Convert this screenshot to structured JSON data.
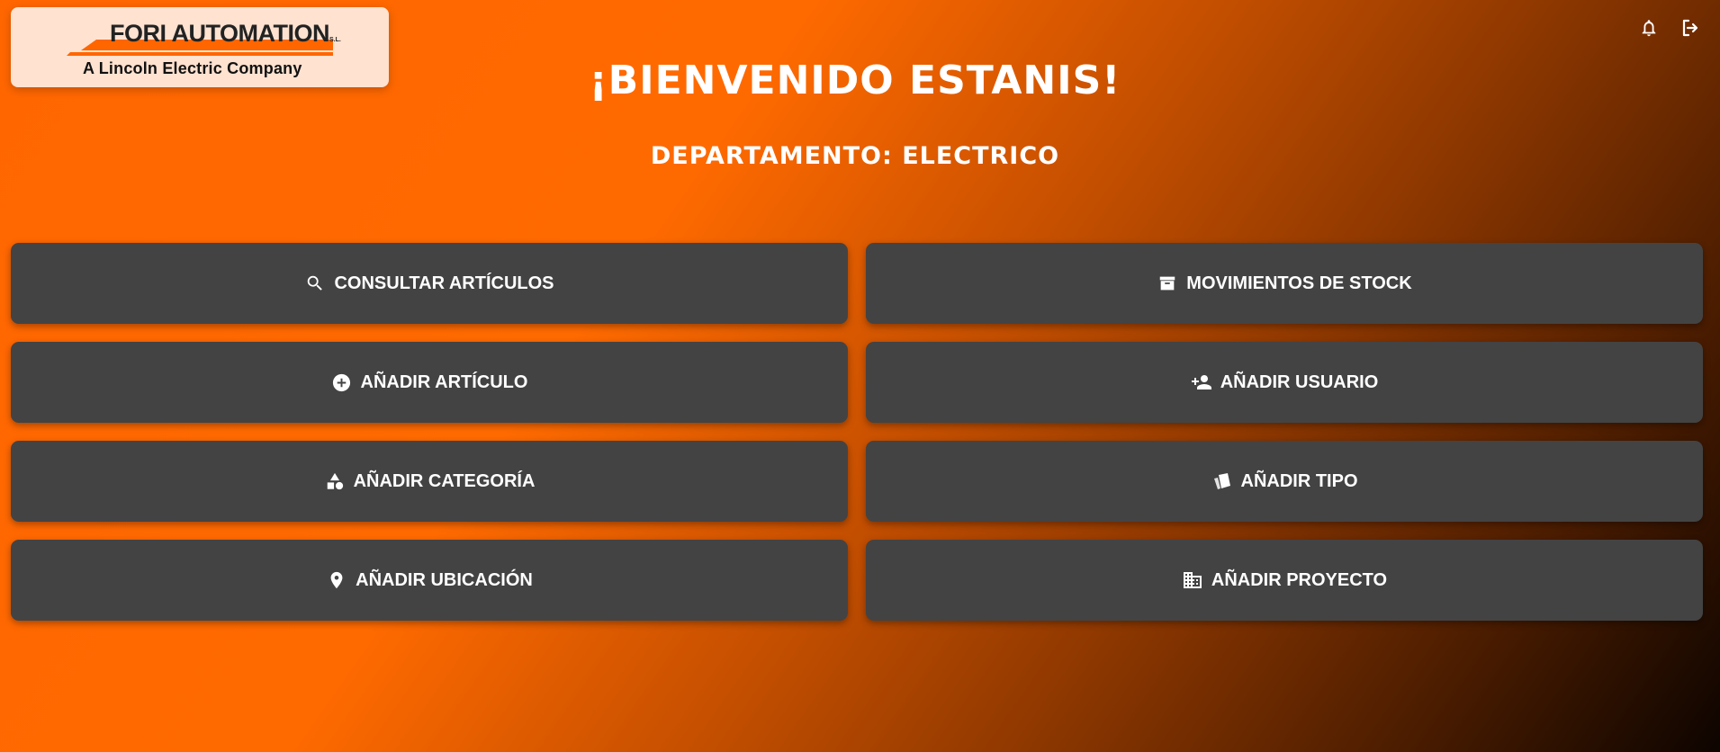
{
  "logo": {
    "title": "FORI AUTOMATION",
    "suffix": "S.L.",
    "subtitle": "A Lincoln Electric Company"
  },
  "header": {
    "icons": [
      "bell-icon",
      "logout-icon"
    ]
  },
  "welcome": "¡BIENVENIDO ESTANIS!",
  "department": "DEPARTAMENTO: ELECTRICO",
  "actions": [
    {
      "label": "CONSULTAR ARTÍCULOS",
      "icon": "search-icon"
    },
    {
      "label": "MOVIMIENTOS DE STOCK",
      "icon": "archive-icon"
    },
    {
      "label": "AÑADIR ARTÍCULO",
      "icon": "add-circle-icon"
    },
    {
      "label": "AÑADIR USUARIO",
      "icon": "person-add-icon"
    },
    {
      "label": "AÑADIR CATEGORÍA",
      "icon": "category-icon"
    },
    {
      "label": "AÑADIR TIPO",
      "icon": "swatch-icon"
    },
    {
      "label": "AÑADIR UBICACIÓN",
      "icon": "location-pin-icon"
    },
    {
      "label": "AÑADIR PROYECTO",
      "icon": "building-icon"
    }
  ],
  "colors": {
    "accent": "#ff6600",
    "tile": "#434343",
    "logo_bg": "#ffe2d0"
  }
}
